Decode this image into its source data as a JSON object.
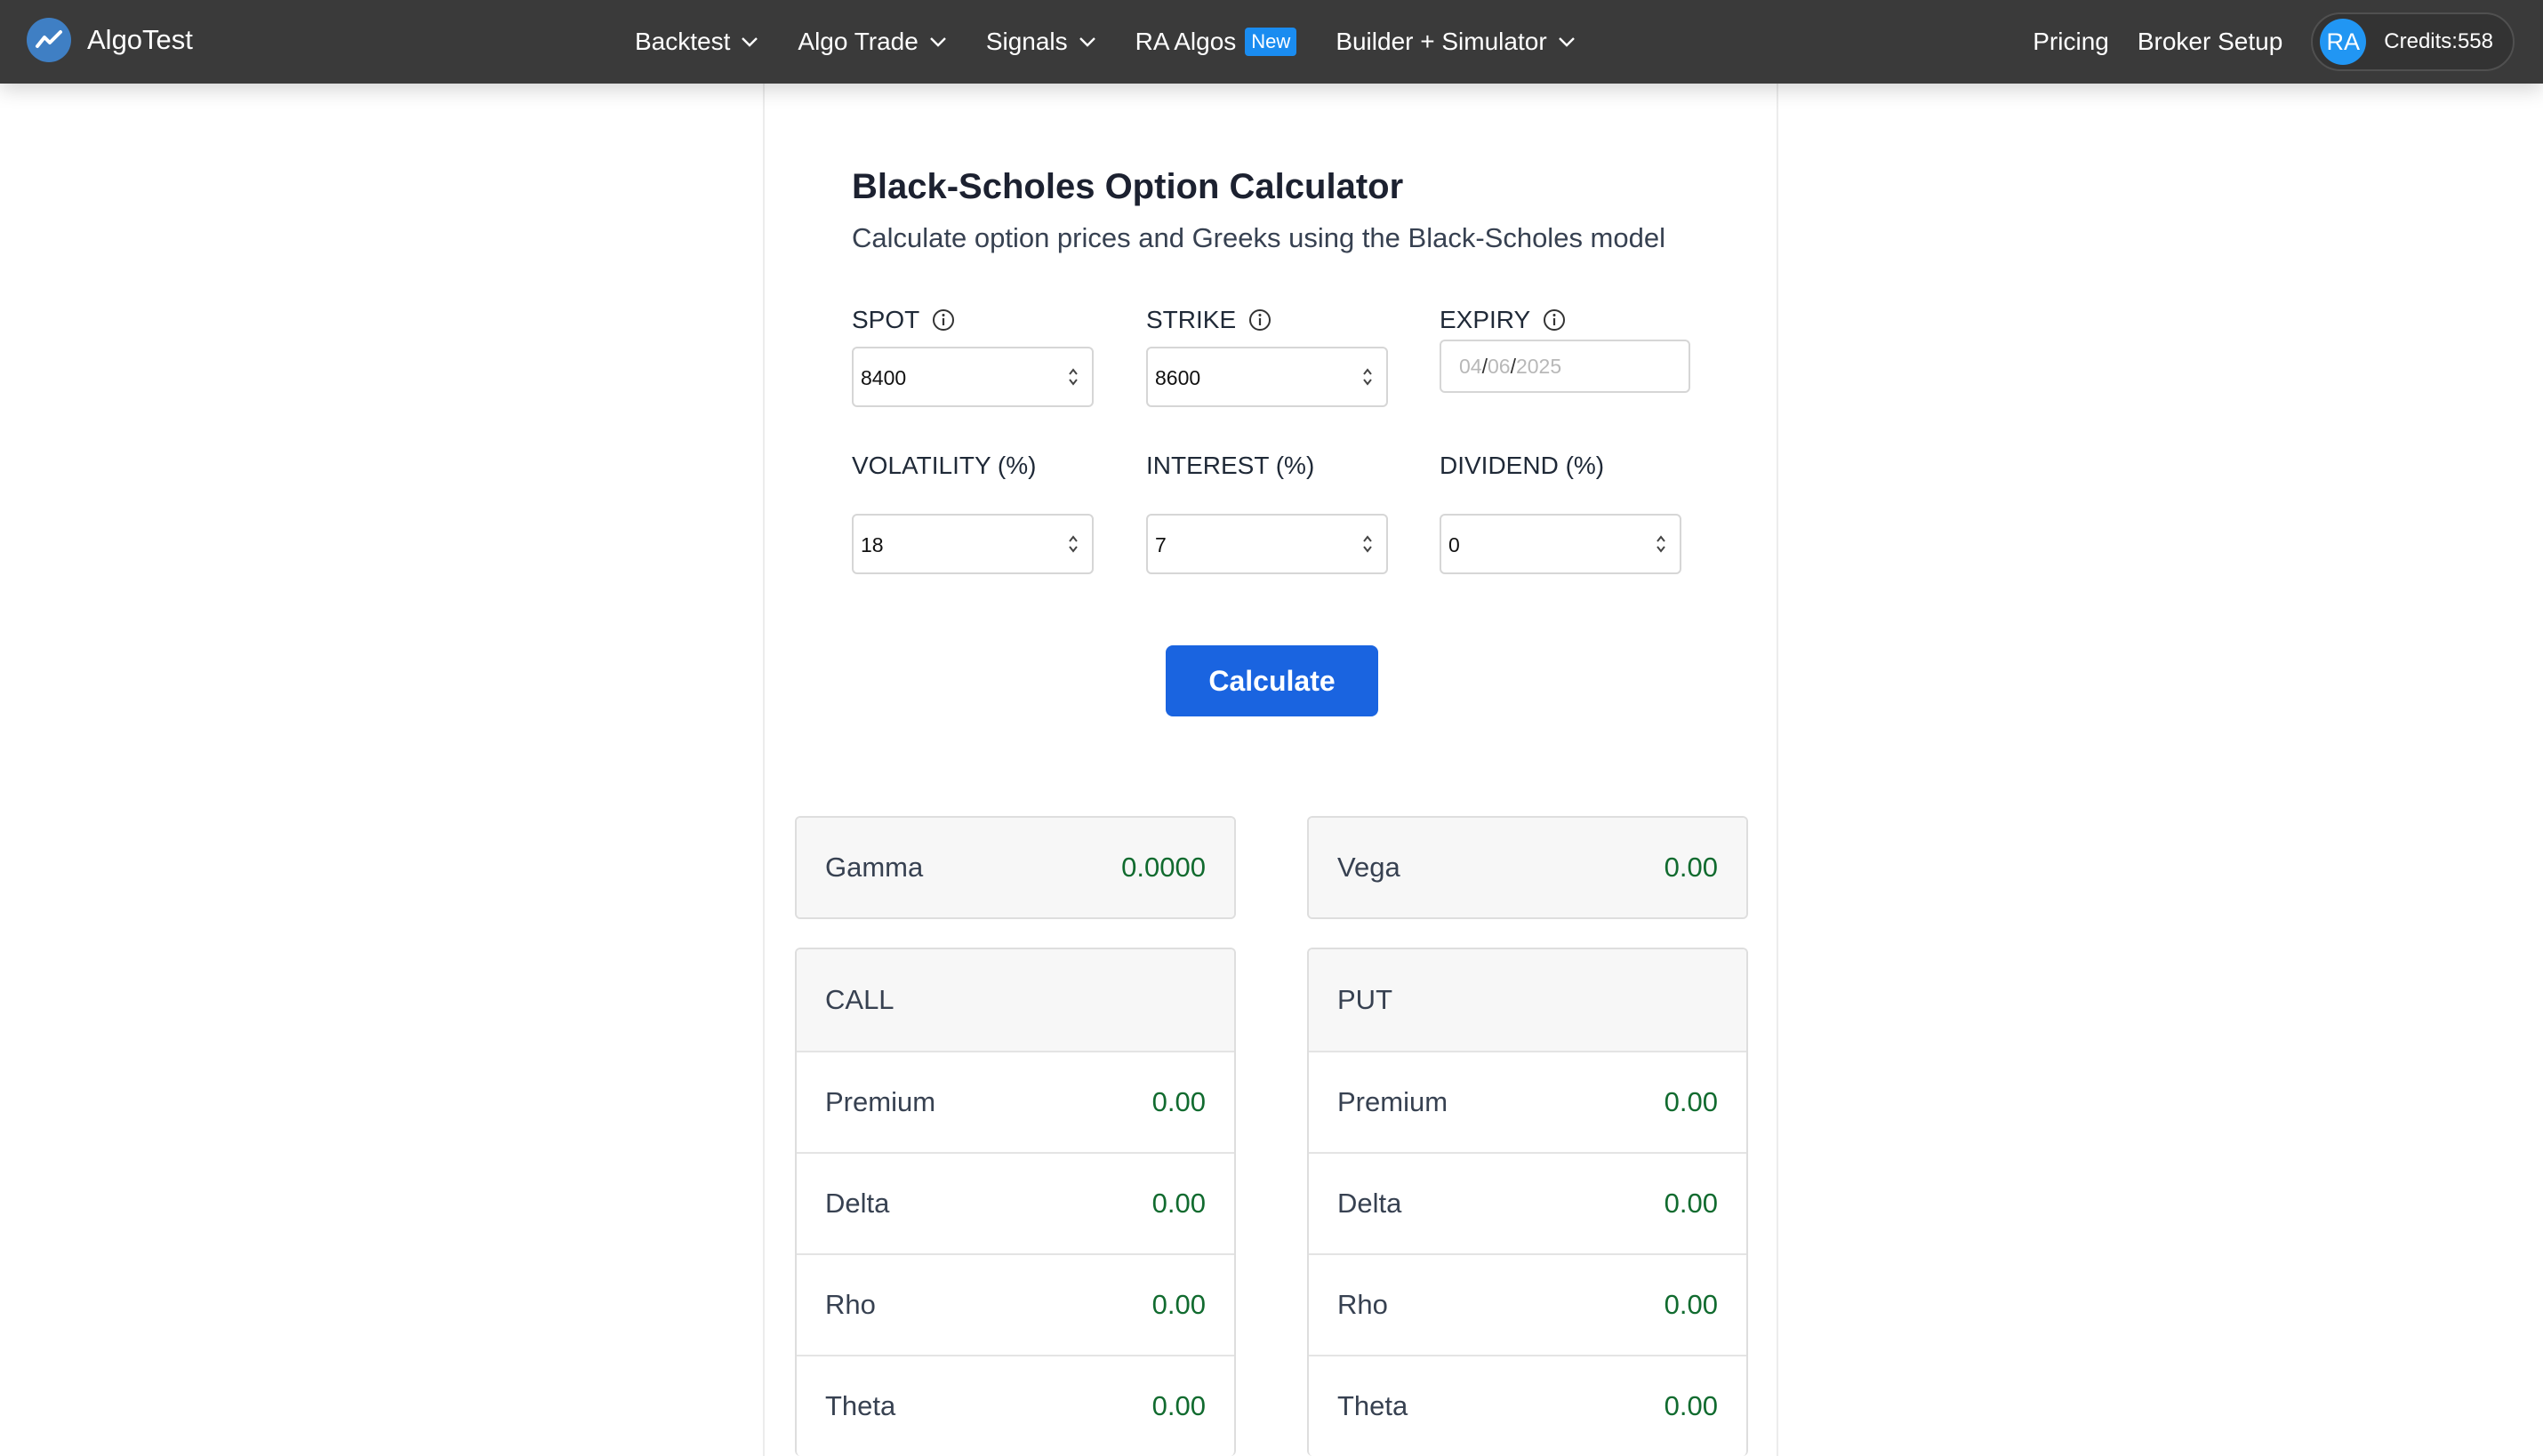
{
  "nav": {
    "brand": "AlgoTest",
    "items": [
      {
        "label": "Backtest",
        "dropdown": true
      },
      {
        "label": "Algo Trade",
        "dropdown": true
      },
      {
        "label": "Signals",
        "dropdown": true
      },
      {
        "label": "RA Algos",
        "badge": "New"
      },
      {
        "label": "Builder + Simulator",
        "dropdown": true
      }
    ],
    "pricing": "Pricing",
    "broker_setup": "Broker Setup",
    "avatar": "RA",
    "credits": "Credits:558"
  },
  "calculator": {
    "title": "Black-Scholes Option Calculator",
    "subtitle": "Calculate option prices and Greeks using the Black-Scholes model",
    "fields": {
      "spot": {
        "label": "SPOT",
        "value": "8400"
      },
      "strike": {
        "label": "STRIKE",
        "value": "8600"
      },
      "expiry": {
        "label": "EXPIRY",
        "day": "04",
        "month": "06",
        "year": "2025"
      },
      "volatility": {
        "label": "VOLATILITY (%)",
        "value": "18"
      },
      "interest": {
        "label": "INTEREST (%)",
        "value": "7"
      },
      "dividend": {
        "label": "DIVIDEND (%)",
        "value": "0"
      }
    },
    "button": "Calculate"
  },
  "results": {
    "gamma": {
      "label": "Gamma",
      "value": "0.0000"
    },
    "vega": {
      "label": "Vega",
      "value": "0.00"
    },
    "call": {
      "header": "CALL",
      "rows": [
        {
          "label": "Premium",
          "value": "0.00"
        },
        {
          "label": "Delta",
          "value": "0.00"
        },
        {
          "label": "Rho",
          "value": "0.00"
        },
        {
          "label": "Theta",
          "value": "0.00"
        }
      ]
    },
    "put": {
      "header": "PUT",
      "rows": [
        {
          "label": "Premium",
          "value": "0.00"
        },
        {
          "label": "Delta",
          "value": "0.00"
        },
        {
          "label": "Rho",
          "value": "0.00"
        },
        {
          "label": "Theta",
          "value": "0.00"
        }
      ]
    }
  },
  "colors": {
    "nav_bg": "#3a3a3a",
    "accent": "#1a64e0",
    "value_green": "#116b2f",
    "badge": "#1a8cf0",
    "avatar": "#2196f3"
  }
}
